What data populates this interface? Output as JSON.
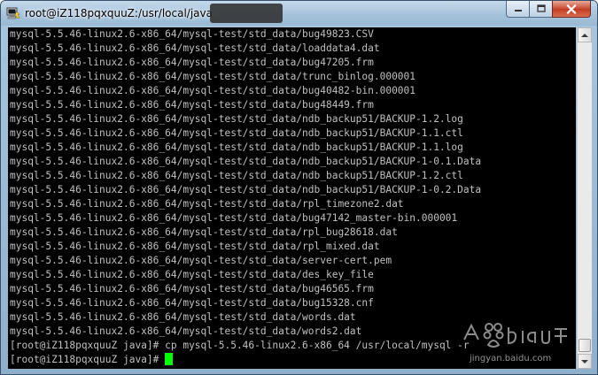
{
  "window": {
    "title": "root@iZ118pqxquuZ:/usr/local/java"
  },
  "terminal": {
    "lines": [
      "mysql-5.5.46-linux2.6-x86_64/mysql-test/std_data/bug49823.CSV",
      "mysql-5.5.46-linux2.6-x86_64/mysql-test/std_data/loaddata4.dat",
      "mysql-5.5.46-linux2.6-x86_64/mysql-test/std_data/bug47205.frm",
      "mysql-5.5.46-linux2.6-x86_64/mysql-test/std_data/trunc_binlog.000001",
      "mysql-5.5.46-linux2.6-x86_64/mysql-test/std_data/bug40482-bin.000001",
      "mysql-5.5.46-linux2.6-x86_64/mysql-test/std_data/bug48449.frm",
      "mysql-5.5.46-linux2.6-x86_64/mysql-test/std_data/ndb_backup51/BACKUP-1.2.log",
      "mysql-5.5.46-linux2.6-x86_64/mysql-test/std_data/ndb_backup51/BACKUP-1.1.ctl",
      "mysql-5.5.46-linux2.6-x86_64/mysql-test/std_data/ndb_backup51/BACKUP-1.1.log",
      "mysql-5.5.46-linux2.6-x86_64/mysql-test/std_data/ndb_backup51/BACKUP-1-0.1.Data",
      "mysql-5.5.46-linux2.6-x86_64/mysql-test/std_data/ndb_backup51/BACKUP-1.2.ctl",
      "mysql-5.5.46-linux2.6-x86_64/mysql-test/std_data/ndb_backup51/BACKUP-1-0.2.Data",
      "mysql-5.5.46-linux2.6-x86_64/mysql-test/std_data/rpl_timezone2.dat",
      "mysql-5.5.46-linux2.6-x86_64/mysql-test/std_data/bug47142_master-bin.000001",
      "mysql-5.5.46-linux2.6-x86_64/mysql-test/std_data/rpl_bug28618.dat",
      "mysql-5.5.46-linux2.6-x86_64/mysql-test/std_data/rpl_mixed.dat",
      "mysql-5.5.46-linux2.6-x86_64/mysql-test/std_data/server-cert.pem",
      "mysql-5.5.46-linux2.6-x86_64/mysql-test/std_data/des_key_file",
      "mysql-5.5.46-linux2.6-x86_64/mysql-test/std_data/bug46565.frm",
      "mysql-5.5.46-linux2.6-x86_64/mysql-test/std_data/bug15328.cnf",
      "mysql-5.5.46-linux2.6-x86_64/mysql-test/std_data/words.dat",
      "mysql-5.5.46-linux2.6-x86_64/mysql-test/std_data/words2.dat",
      "[root@iZ118pqxquuZ java]# cp mysql-5.5.46-linux2.6-x86_64 /usr/local/mysql -r"
    ],
    "prompt": "[root@iZ118pqxquuZ java]# "
  },
  "watermark": {
    "text": "jingyan.baidu.com"
  },
  "colors": {
    "terminal_bg": "#000000",
    "terminal_fg": "#c0c0c0",
    "cursor": "#00ff00"
  },
  "icons": {
    "app": "putty-icon",
    "minimize": "minimize-icon",
    "maximize": "maximize-icon",
    "close": "close-icon",
    "scroll_up": "scroll-up-icon",
    "scroll_down": "scroll-down-icon"
  }
}
